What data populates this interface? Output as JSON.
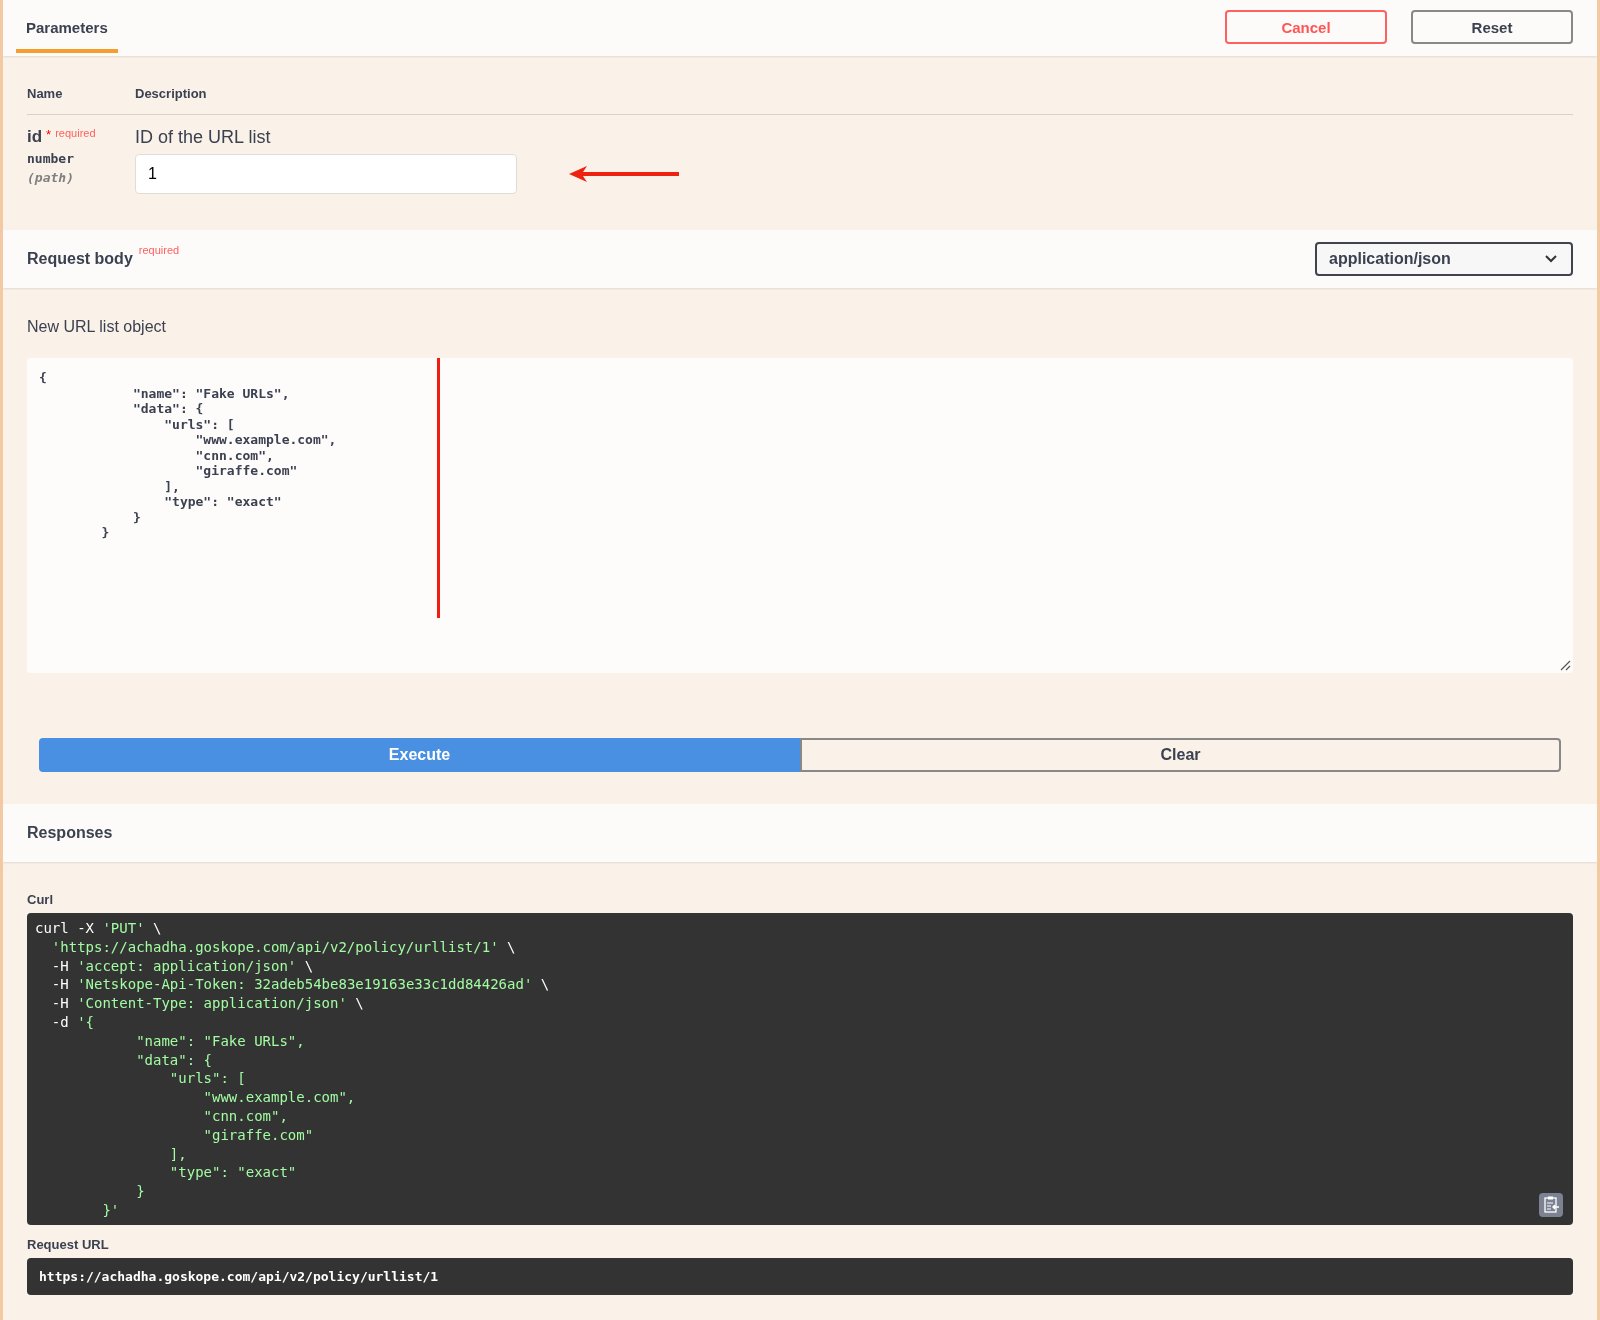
{
  "tabs": [
    {
      "label": "Parameters",
      "selected": true
    }
  ],
  "actions": [
    {
      "label": "Cancel",
      "kind": "danger"
    },
    {
      "label": "Reset",
      "kind": "plain"
    }
  ],
  "parameters": {
    "columns": [
      "Name",
      "Description"
    ],
    "rows": [
      {
        "name": "id",
        "required_mark": "*",
        "required_label": "required",
        "type": "number",
        "location": "(path)",
        "description": "ID of the URL list",
        "value": "1"
      }
    ]
  },
  "request_body": {
    "title": "Request body",
    "required_label": "required",
    "content_type": "application/json",
    "description": "New URL list object",
    "code": "{\n            \"name\": \"Fake URLs\",\n            \"data\": {\n                \"urls\": [\n                    \"www.example.com\",\n                    \"cnn.com\",\n                    \"giraffe.com\"\n                ],\n                \"type\": \"exact\"\n            }\n        }"
  },
  "buttons": [
    {
      "label": "Execute",
      "kind": "primary"
    },
    {
      "label": "Clear",
      "kind": "outline"
    }
  ],
  "responses": {
    "title": "Responses",
    "curl_label": "Curl",
    "curl_lines": [
      [
        {
          "text": "curl -X ",
          "kind": "cmd"
        },
        {
          "text": "'PUT'",
          "kind": "str"
        },
        {
          "text": " \\",
          "kind": "cmd"
        }
      ],
      [
        {
          "text": "  'https://achadha.goskope.com/api/v2/policy/urllist/1'",
          "kind": "str"
        },
        {
          "text": " \\",
          "kind": "cmd"
        }
      ],
      [
        {
          "text": "  -H ",
          "kind": "cmd"
        },
        {
          "text": "'accept: application/json'",
          "kind": "str"
        },
        {
          "text": " \\",
          "kind": "cmd"
        }
      ],
      [
        {
          "text": "  -H ",
          "kind": "cmd"
        },
        {
          "text": "'Netskope-Api-Token: 32adeb54be83e19163e33c1dd84426ad'",
          "kind": "str"
        },
        {
          "text": " \\",
          "kind": "cmd"
        }
      ],
      [
        {
          "text": "  -H ",
          "kind": "cmd"
        },
        {
          "text": "'Content-Type: application/json'",
          "kind": "str"
        },
        {
          "text": " \\",
          "kind": "cmd"
        }
      ],
      [
        {
          "text": "  -d ",
          "kind": "cmd"
        },
        {
          "text": "'{",
          "kind": "str"
        }
      ],
      [
        {
          "text": "            \"name\": \"Fake URLs\",",
          "kind": "str"
        }
      ],
      [
        {
          "text": "            \"data\": {",
          "kind": "str"
        }
      ],
      [
        {
          "text": "                \"urls\": [",
          "kind": "str"
        }
      ],
      [
        {
          "text": "                    \"www.example.com\",",
          "kind": "str"
        }
      ],
      [
        {
          "text": "                    \"cnn.com\",",
          "kind": "str"
        }
      ],
      [
        {
          "text": "                    \"giraffe.com\"",
          "kind": "str"
        }
      ],
      [
        {
          "text": "                ],",
          "kind": "str"
        }
      ],
      [
        {
          "text": "                \"type\": \"exact\"",
          "kind": "str"
        }
      ],
      [
        {
          "text": "            }",
          "kind": "str"
        }
      ],
      [
        {
          "text": "        }'",
          "kind": "str"
        }
      ]
    ],
    "request_url_label": "Request URL",
    "request_url": "https://achadha.goskope.com/api/v2/policy/urllist/1"
  }
}
